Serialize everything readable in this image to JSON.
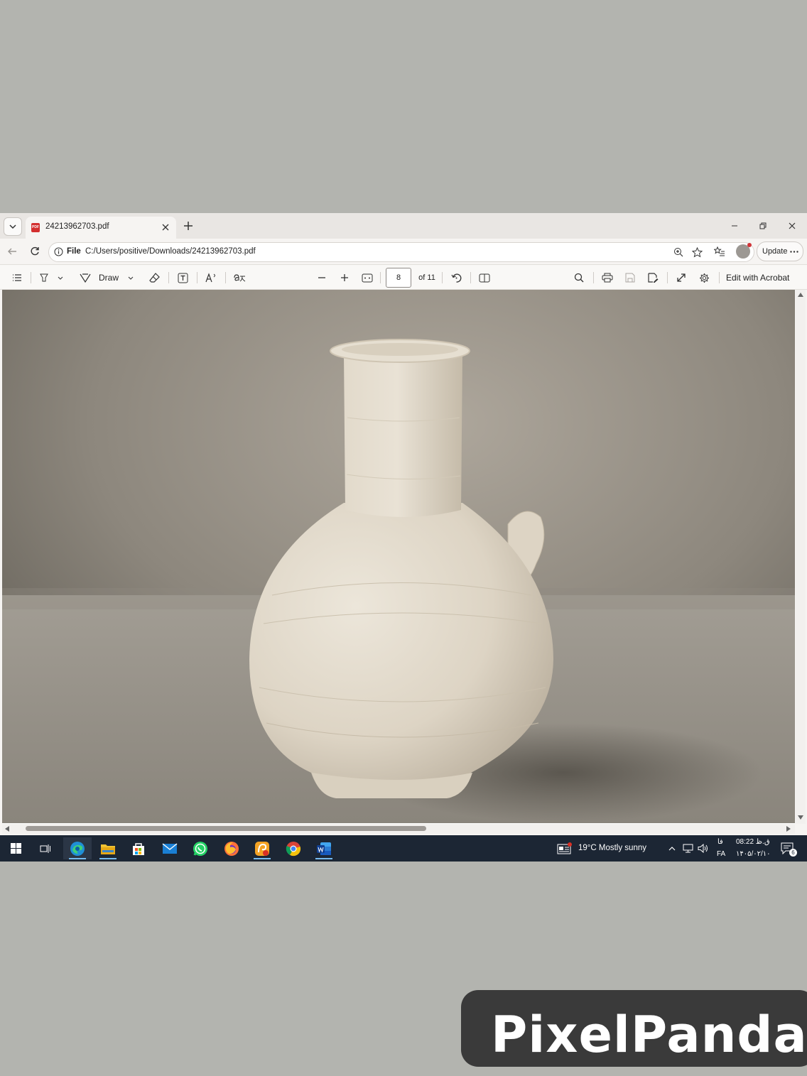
{
  "tab": {
    "title": "24213962703.pdf"
  },
  "address_bar": {
    "scheme": "File",
    "url": "C:/Users/positive/Downloads/24213962703.pdf",
    "update_label": "Update"
  },
  "pdf_toolbar": {
    "draw_label": "Draw",
    "page_current": "8",
    "page_total": "of 11",
    "edit_label": "Edit with Acrobat"
  },
  "document": {
    "content": "vase-photo"
  },
  "taskbar": {
    "weather": "19°C  Mostly sunny",
    "language_top": "فا",
    "language_bottom": "FA",
    "time": "ق.ظ 08:22",
    "date": "۱۴۰۵/۰۲/۱۰",
    "notification_count": "6",
    "apps": [
      "start-icon",
      "task-view-icon",
      "edge-icon",
      "file-explorer-icon",
      "store-icon",
      "mail-icon",
      "whatsapp-icon",
      "firefox-icon",
      "paint-app-icon",
      "chrome-icon",
      "word-icon"
    ]
  },
  "watermark": {
    "text": "PixelPanda"
  },
  "colors": {
    "page_background": "#b3b4af",
    "taskbar": "#1c2634",
    "pdf_badge": "#d32f2f",
    "vase": "#e4dccd"
  }
}
